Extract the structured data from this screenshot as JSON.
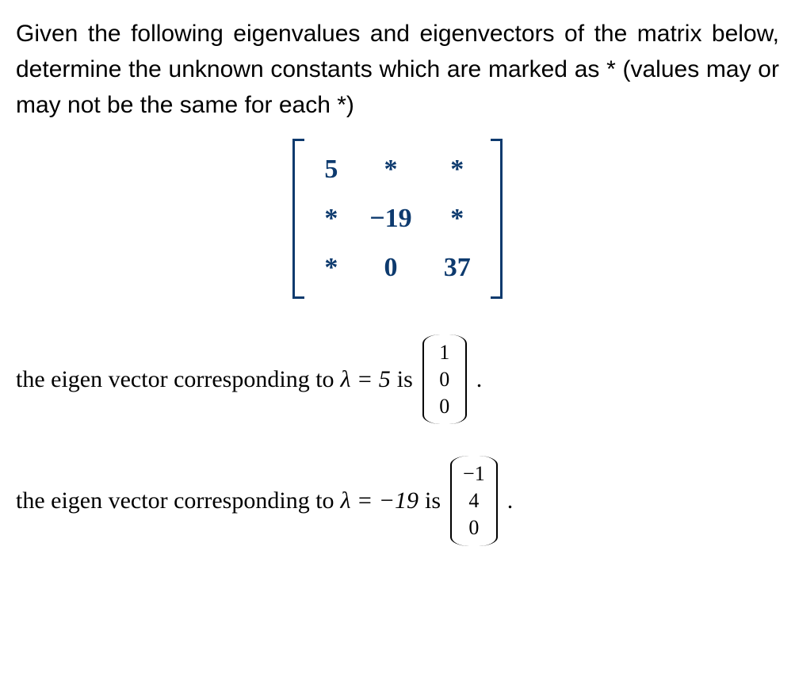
{
  "problem": "Given the following eigenvalues and eigenvectors of the matrix below, determine the unknown constants which are marked as * (values may or may not be the same for each *)",
  "matrix": {
    "r0c0": "5",
    "r0c1": "*",
    "r0c2": "*",
    "r1c0": "*",
    "r1c1": "−19",
    "r1c2": "*",
    "r2c0": "*",
    "r2c1": "0",
    "r2c2": "37"
  },
  "eigen1": {
    "text_prefix": "the eigen vector corresponding to ",
    "lambda_expr": "λ = 5",
    "text_suffix": " is ",
    "vector": {
      "v0": "1",
      "v1": "0",
      "v2": "0"
    },
    "period": "."
  },
  "eigen2": {
    "text_prefix": "the eigen vector corresponding to ",
    "lambda_expr": "λ = −19",
    "text_suffix": " is ",
    "vector": {
      "v0": "−1",
      "v1": "4",
      "v2": "0"
    },
    "period": "."
  }
}
